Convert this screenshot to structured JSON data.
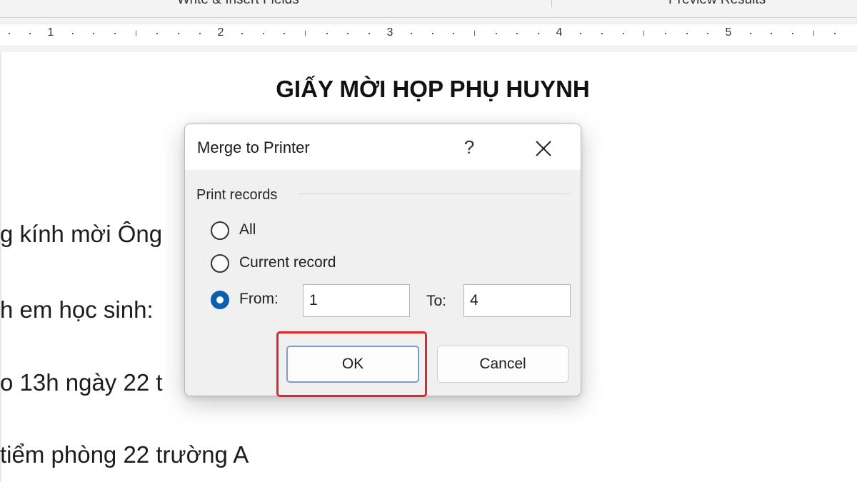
{
  "ribbon": {
    "group_left": "Write & Insert Fields",
    "group_right": "Preview Results"
  },
  "ruler": {
    "numbers": [
      "1",
      "2",
      "3",
      "4",
      "5"
    ]
  },
  "document": {
    "title": "GIẤY MỜI HỌP PHỤ HUYNH",
    "lines": [
      "g kính mời Ông",
      "h em học sinh:",
      "o 13h ngày 22 t",
      "tiểm phòng 22 trường A"
    ]
  },
  "dialog": {
    "title": "Merge to Printer",
    "help_label": "?",
    "group_label": "Print records",
    "options": [
      {
        "label": "All",
        "checked": false
      },
      {
        "label": "Current record",
        "checked": false
      },
      {
        "label": "From:",
        "checked": true
      }
    ],
    "from_value": "1",
    "to_label": "To:",
    "to_value": "4",
    "ok_label": "OK",
    "cancel_label": "Cancel"
  },
  "colors": {
    "highlight": "#e0252f",
    "radio_accent": "#0a5fb4"
  }
}
